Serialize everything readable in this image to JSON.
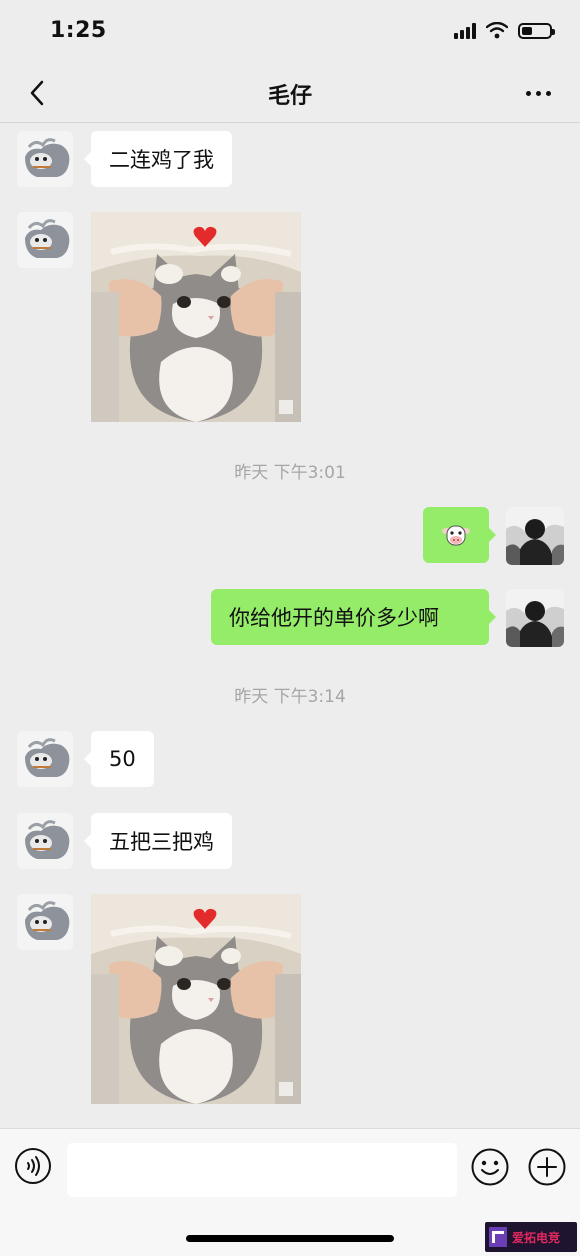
{
  "status_bar": {
    "time": "1:25",
    "battery_fraction": 0.4
  },
  "nav": {
    "title": "毛仔"
  },
  "messages": {
    "m1": {
      "text": "二连鸡了我"
    },
    "ts1": {
      "text": "昨天 下午3:01"
    },
    "m3": {
      "emoji_name": "cow-face-emoji"
    },
    "m4": {
      "text": "你给他开的单价多少啊"
    },
    "ts2": {
      "text": "昨天 下午3:14"
    },
    "m5": {
      "text": "50"
    },
    "m6": {
      "text": "五把三把鸡"
    }
  },
  "input": {
    "value": ""
  },
  "watermark": {
    "text": "爱拓电竞"
  },
  "colors": {
    "sent_bubble": "#95ec69",
    "received_bubble": "#ffffff",
    "background": "#ededed"
  },
  "icons": [
    "back-chevron-icon",
    "more-dots-icon",
    "voice-icon",
    "emoji-icon",
    "plus-icon",
    "heart-icon"
  ]
}
